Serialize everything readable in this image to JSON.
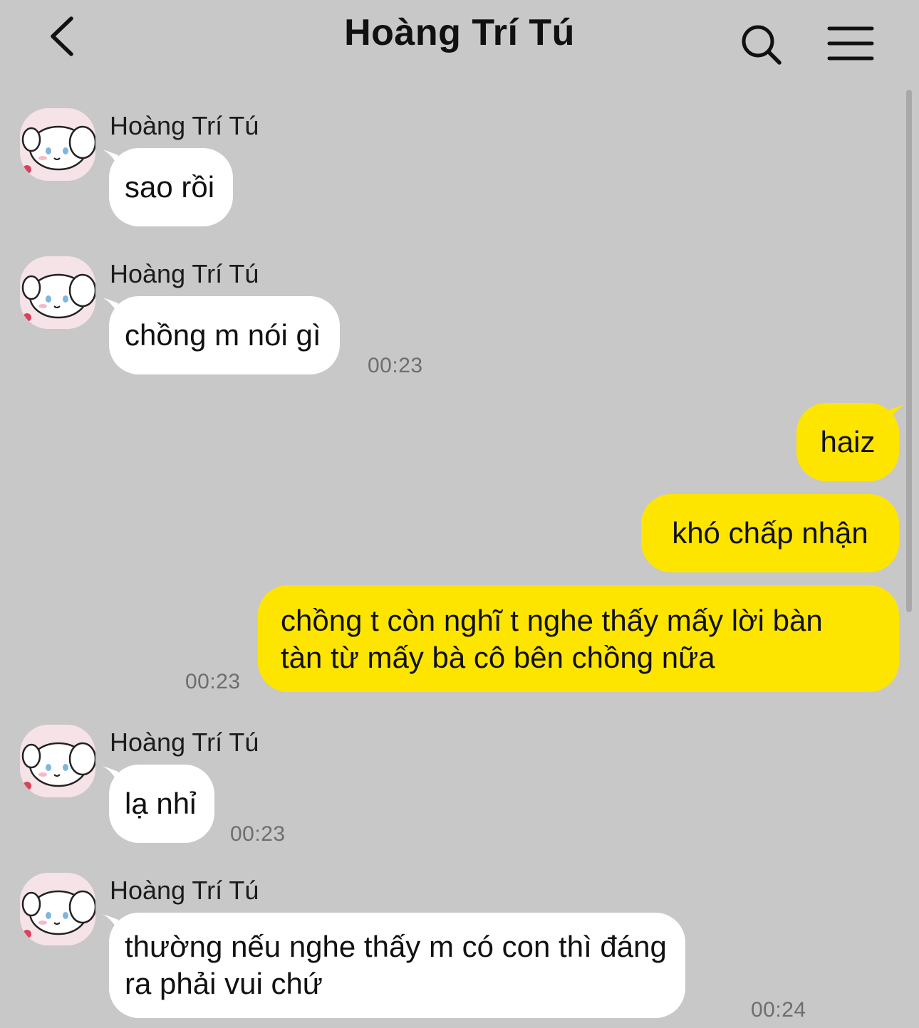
{
  "header": {
    "title": "Hoàng Trí Tú",
    "back_icon": "chevron-left-icon",
    "search_icon": "search-icon",
    "menu_icon": "hamburger-menu-icon"
  },
  "colors": {
    "background": "#c8c8c8",
    "incoming_bubble": "#ffffff",
    "outgoing_bubble": "#fee500",
    "timestamp": "#6e6e6e"
  },
  "messages": [
    {
      "direction": "in",
      "sender": "Hoàng Trí Tú",
      "text": "sao rồi",
      "time": ""
    },
    {
      "direction": "in",
      "sender": "Hoàng Trí Tú",
      "text": "chồng m nói gì",
      "time": "00:23"
    },
    {
      "direction": "out",
      "text": "haiz",
      "time": ""
    },
    {
      "direction": "out",
      "text": "khó chấp nhận",
      "time": ""
    },
    {
      "direction": "out",
      "lines": [
        "chồng t còn nghĩ t nghe thấy mấy lời bàn",
        "tàn từ mấy bà cô bên chồng nữa"
      ],
      "time": "00:23"
    },
    {
      "direction": "in",
      "sender": "Hoàng Trí Tú",
      "text": "lạ nhỉ",
      "time": "00:23"
    },
    {
      "direction": "in",
      "sender": "Hoàng Trí Tú",
      "lines": [
        "thường nếu nghe thấy m có con thì đáng",
        "ra phải vui chứ"
      ],
      "time": "00:24"
    }
  ]
}
